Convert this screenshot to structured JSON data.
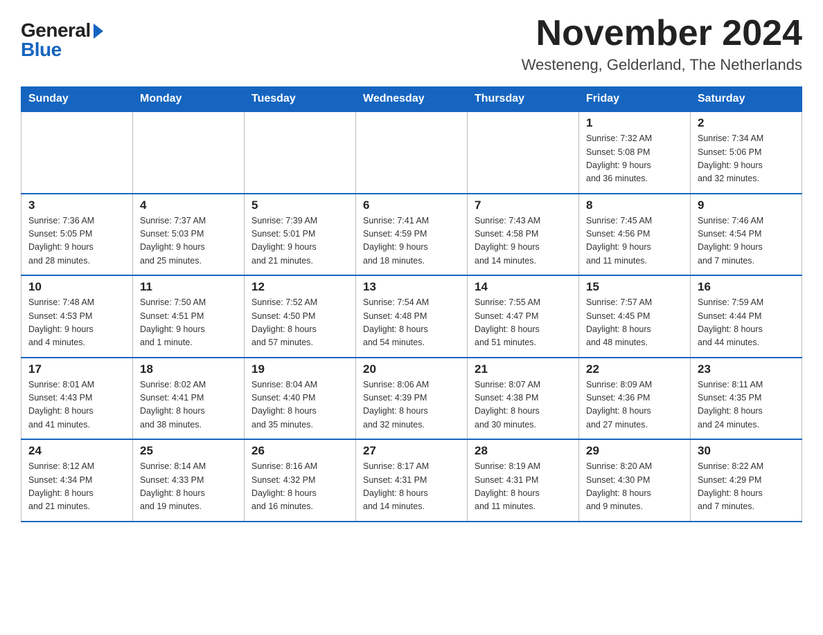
{
  "logo": {
    "general": "General",
    "blue": "Blue"
  },
  "title": "November 2024",
  "location": "Westeneng, Gelderland, The Netherlands",
  "headers": [
    "Sunday",
    "Monday",
    "Tuesday",
    "Wednesday",
    "Thursday",
    "Friday",
    "Saturday"
  ],
  "weeks": [
    [
      {
        "day": "",
        "info": ""
      },
      {
        "day": "",
        "info": ""
      },
      {
        "day": "",
        "info": ""
      },
      {
        "day": "",
        "info": ""
      },
      {
        "day": "",
        "info": ""
      },
      {
        "day": "1",
        "info": "Sunrise: 7:32 AM\nSunset: 5:08 PM\nDaylight: 9 hours\nand 36 minutes."
      },
      {
        "day": "2",
        "info": "Sunrise: 7:34 AM\nSunset: 5:06 PM\nDaylight: 9 hours\nand 32 minutes."
      }
    ],
    [
      {
        "day": "3",
        "info": "Sunrise: 7:36 AM\nSunset: 5:05 PM\nDaylight: 9 hours\nand 28 minutes."
      },
      {
        "day": "4",
        "info": "Sunrise: 7:37 AM\nSunset: 5:03 PM\nDaylight: 9 hours\nand 25 minutes."
      },
      {
        "day": "5",
        "info": "Sunrise: 7:39 AM\nSunset: 5:01 PM\nDaylight: 9 hours\nand 21 minutes."
      },
      {
        "day": "6",
        "info": "Sunrise: 7:41 AM\nSunset: 4:59 PM\nDaylight: 9 hours\nand 18 minutes."
      },
      {
        "day": "7",
        "info": "Sunrise: 7:43 AM\nSunset: 4:58 PM\nDaylight: 9 hours\nand 14 minutes."
      },
      {
        "day": "8",
        "info": "Sunrise: 7:45 AM\nSunset: 4:56 PM\nDaylight: 9 hours\nand 11 minutes."
      },
      {
        "day": "9",
        "info": "Sunrise: 7:46 AM\nSunset: 4:54 PM\nDaylight: 9 hours\nand 7 minutes."
      }
    ],
    [
      {
        "day": "10",
        "info": "Sunrise: 7:48 AM\nSunset: 4:53 PM\nDaylight: 9 hours\nand 4 minutes."
      },
      {
        "day": "11",
        "info": "Sunrise: 7:50 AM\nSunset: 4:51 PM\nDaylight: 9 hours\nand 1 minute."
      },
      {
        "day": "12",
        "info": "Sunrise: 7:52 AM\nSunset: 4:50 PM\nDaylight: 8 hours\nand 57 minutes."
      },
      {
        "day": "13",
        "info": "Sunrise: 7:54 AM\nSunset: 4:48 PM\nDaylight: 8 hours\nand 54 minutes."
      },
      {
        "day": "14",
        "info": "Sunrise: 7:55 AM\nSunset: 4:47 PM\nDaylight: 8 hours\nand 51 minutes."
      },
      {
        "day": "15",
        "info": "Sunrise: 7:57 AM\nSunset: 4:45 PM\nDaylight: 8 hours\nand 48 minutes."
      },
      {
        "day": "16",
        "info": "Sunrise: 7:59 AM\nSunset: 4:44 PM\nDaylight: 8 hours\nand 44 minutes."
      }
    ],
    [
      {
        "day": "17",
        "info": "Sunrise: 8:01 AM\nSunset: 4:43 PM\nDaylight: 8 hours\nand 41 minutes."
      },
      {
        "day": "18",
        "info": "Sunrise: 8:02 AM\nSunset: 4:41 PM\nDaylight: 8 hours\nand 38 minutes."
      },
      {
        "day": "19",
        "info": "Sunrise: 8:04 AM\nSunset: 4:40 PM\nDaylight: 8 hours\nand 35 minutes."
      },
      {
        "day": "20",
        "info": "Sunrise: 8:06 AM\nSunset: 4:39 PM\nDaylight: 8 hours\nand 32 minutes."
      },
      {
        "day": "21",
        "info": "Sunrise: 8:07 AM\nSunset: 4:38 PM\nDaylight: 8 hours\nand 30 minutes."
      },
      {
        "day": "22",
        "info": "Sunrise: 8:09 AM\nSunset: 4:36 PM\nDaylight: 8 hours\nand 27 minutes."
      },
      {
        "day": "23",
        "info": "Sunrise: 8:11 AM\nSunset: 4:35 PM\nDaylight: 8 hours\nand 24 minutes."
      }
    ],
    [
      {
        "day": "24",
        "info": "Sunrise: 8:12 AM\nSunset: 4:34 PM\nDaylight: 8 hours\nand 21 minutes."
      },
      {
        "day": "25",
        "info": "Sunrise: 8:14 AM\nSunset: 4:33 PM\nDaylight: 8 hours\nand 19 minutes."
      },
      {
        "day": "26",
        "info": "Sunrise: 8:16 AM\nSunset: 4:32 PM\nDaylight: 8 hours\nand 16 minutes."
      },
      {
        "day": "27",
        "info": "Sunrise: 8:17 AM\nSunset: 4:31 PM\nDaylight: 8 hours\nand 14 minutes."
      },
      {
        "day": "28",
        "info": "Sunrise: 8:19 AM\nSunset: 4:31 PM\nDaylight: 8 hours\nand 11 minutes."
      },
      {
        "day": "29",
        "info": "Sunrise: 8:20 AM\nSunset: 4:30 PM\nDaylight: 8 hours\nand 9 minutes."
      },
      {
        "day": "30",
        "info": "Sunrise: 8:22 AM\nSunset: 4:29 PM\nDaylight: 8 hours\nand 7 minutes."
      }
    ]
  ]
}
